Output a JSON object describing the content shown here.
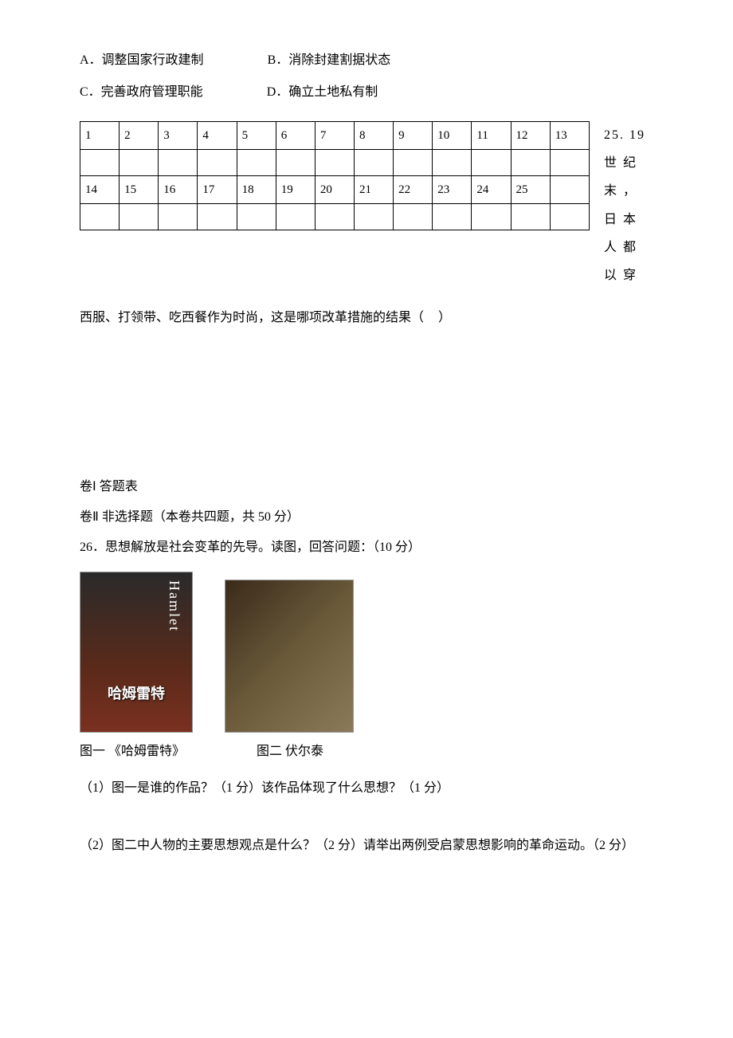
{
  "options": {
    "a": "A．调整国家行政建制",
    "b": "B．消除封建割据状态",
    "c": "C．完善政府管理职能",
    "d": "D．确立土地私有制"
  },
  "table": {
    "row1": [
      "1",
      "2",
      "3",
      "4",
      "5",
      "6",
      "7",
      "8",
      "9",
      "10",
      "11",
      "12",
      "13"
    ],
    "row2": [
      "14",
      "15",
      "16",
      "17",
      "18",
      "19",
      "20",
      "21",
      "22",
      "23",
      "24",
      "25",
      ""
    ]
  },
  "side": {
    "s1": "25. 19",
    "s2": "世 纪",
    "s3": "末 ，",
    "s4": "日 本",
    "s5": "人 都",
    "s6": "以 穿"
  },
  "q25_tail": "西服、打领带、吃西餐作为时尚，这是哪项改革措施的结果（",
  "q25_close": "）",
  "section1": "卷Ⅰ  答题表",
  "section2": "卷Ⅱ 非选择题（本卷共四题，共 50 分）",
  "q26": "26．思想解放是社会变革的先导。读图，回答问题：（10 分）",
  "hamlet_text": "哈姆雷特",
  "hamlet_side": "Hamlet",
  "caption1": "图一 《哈姆雷特》",
  "caption2": "图二   伏尔泰",
  "q26_1": "（1）图一是谁的作品？（1 分）该作品体现了什么思想？（1 分）",
  "q26_2": "（2）图二中人物的主要思想观点是什么？（2 分）请举出两例受启蒙思想影响的革命运动。（2 分）"
}
